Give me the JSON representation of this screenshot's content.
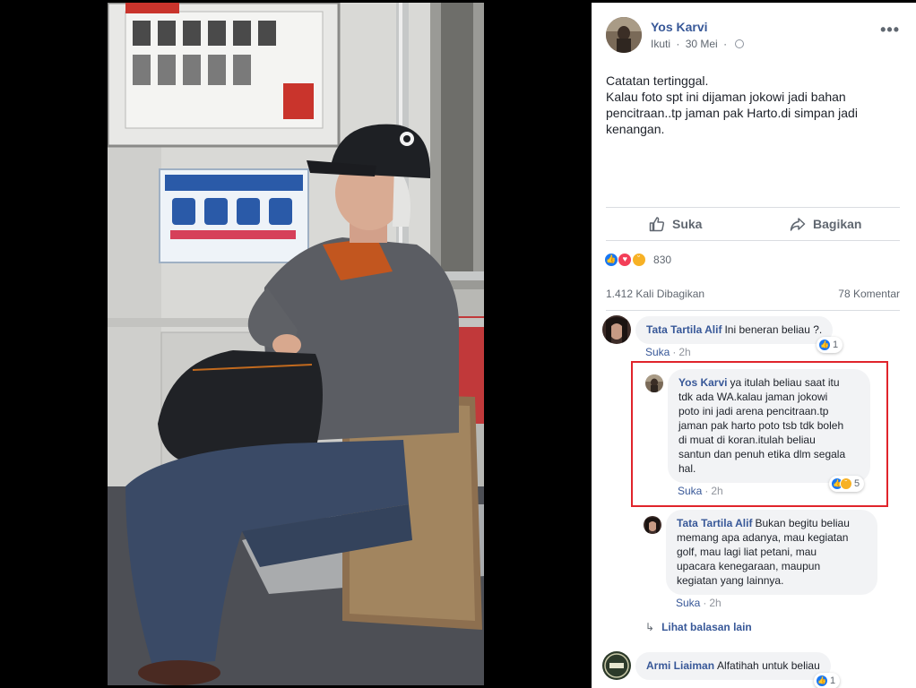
{
  "post": {
    "author": "Yos Karvi",
    "follow_label": "Ikuti",
    "separator": "·",
    "date": "30 Mei",
    "more_icon": "more-horizontal-icon",
    "text_lines": [
      "Catatan tertinggal.",
      "Kalau foto spt ini dijaman jokowi jadi bahan",
      "pencitraan..tp jaman pak Harto.di simpan jadi",
      "kenangan."
    ]
  },
  "actions": {
    "like_label": "Suka",
    "share_label": "Bagikan"
  },
  "reactions": {
    "count": "830",
    "types": [
      "like",
      "love",
      "sad"
    ]
  },
  "stats": {
    "shares": "1.412 Kali Dibagikan",
    "comments": "78 Komentar"
  },
  "comments": [
    {
      "author": "Tata Tartila Alif",
      "lines": [
        "Ini beneran beliau ?."
      ],
      "like_label": "Suka",
      "time": "2h",
      "reaction_count": "1"
    },
    {
      "author": "Yos Karvi",
      "lines": [
        "ya itulah beliau saat itu",
        "tdk ada WA.kalau jaman jokowi",
        "poto ini jadi arena pencitraan.tp",
        "jaman pak harto poto tsb tdk boleh",
        "di muat di koran.itulah beliau",
        "santun dan penuh etika dlm segala",
        "hal."
      ],
      "like_label": "Suka",
      "time": "2h",
      "reaction_count": "5"
    },
    {
      "author": "Tata Tartila Alif",
      "lines": [
        "Bukan begitu beliau",
        "memang apa adanya, mau kegiatan",
        "golf, mau lagi liat petani, mau",
        "upacara kenegaraan, maupun",
        "kegiatan yang lainnya."
      ],
      "like_label": "Suka",
      "time": "2h"
    },
    {
      "author": "Armi Liaiman",
      "lines": [
        "Alfatihah untuk beliau"
      ],
      "reaction_count": "1"
    }
  ],
  "more_replies_label": "Lihat balasan lain",
  "colors": {
    "link_blue": "#385898",
    "highlight_red": "#e0242b",
    "bubble_gray": "#f2f3f5"
  }
}
